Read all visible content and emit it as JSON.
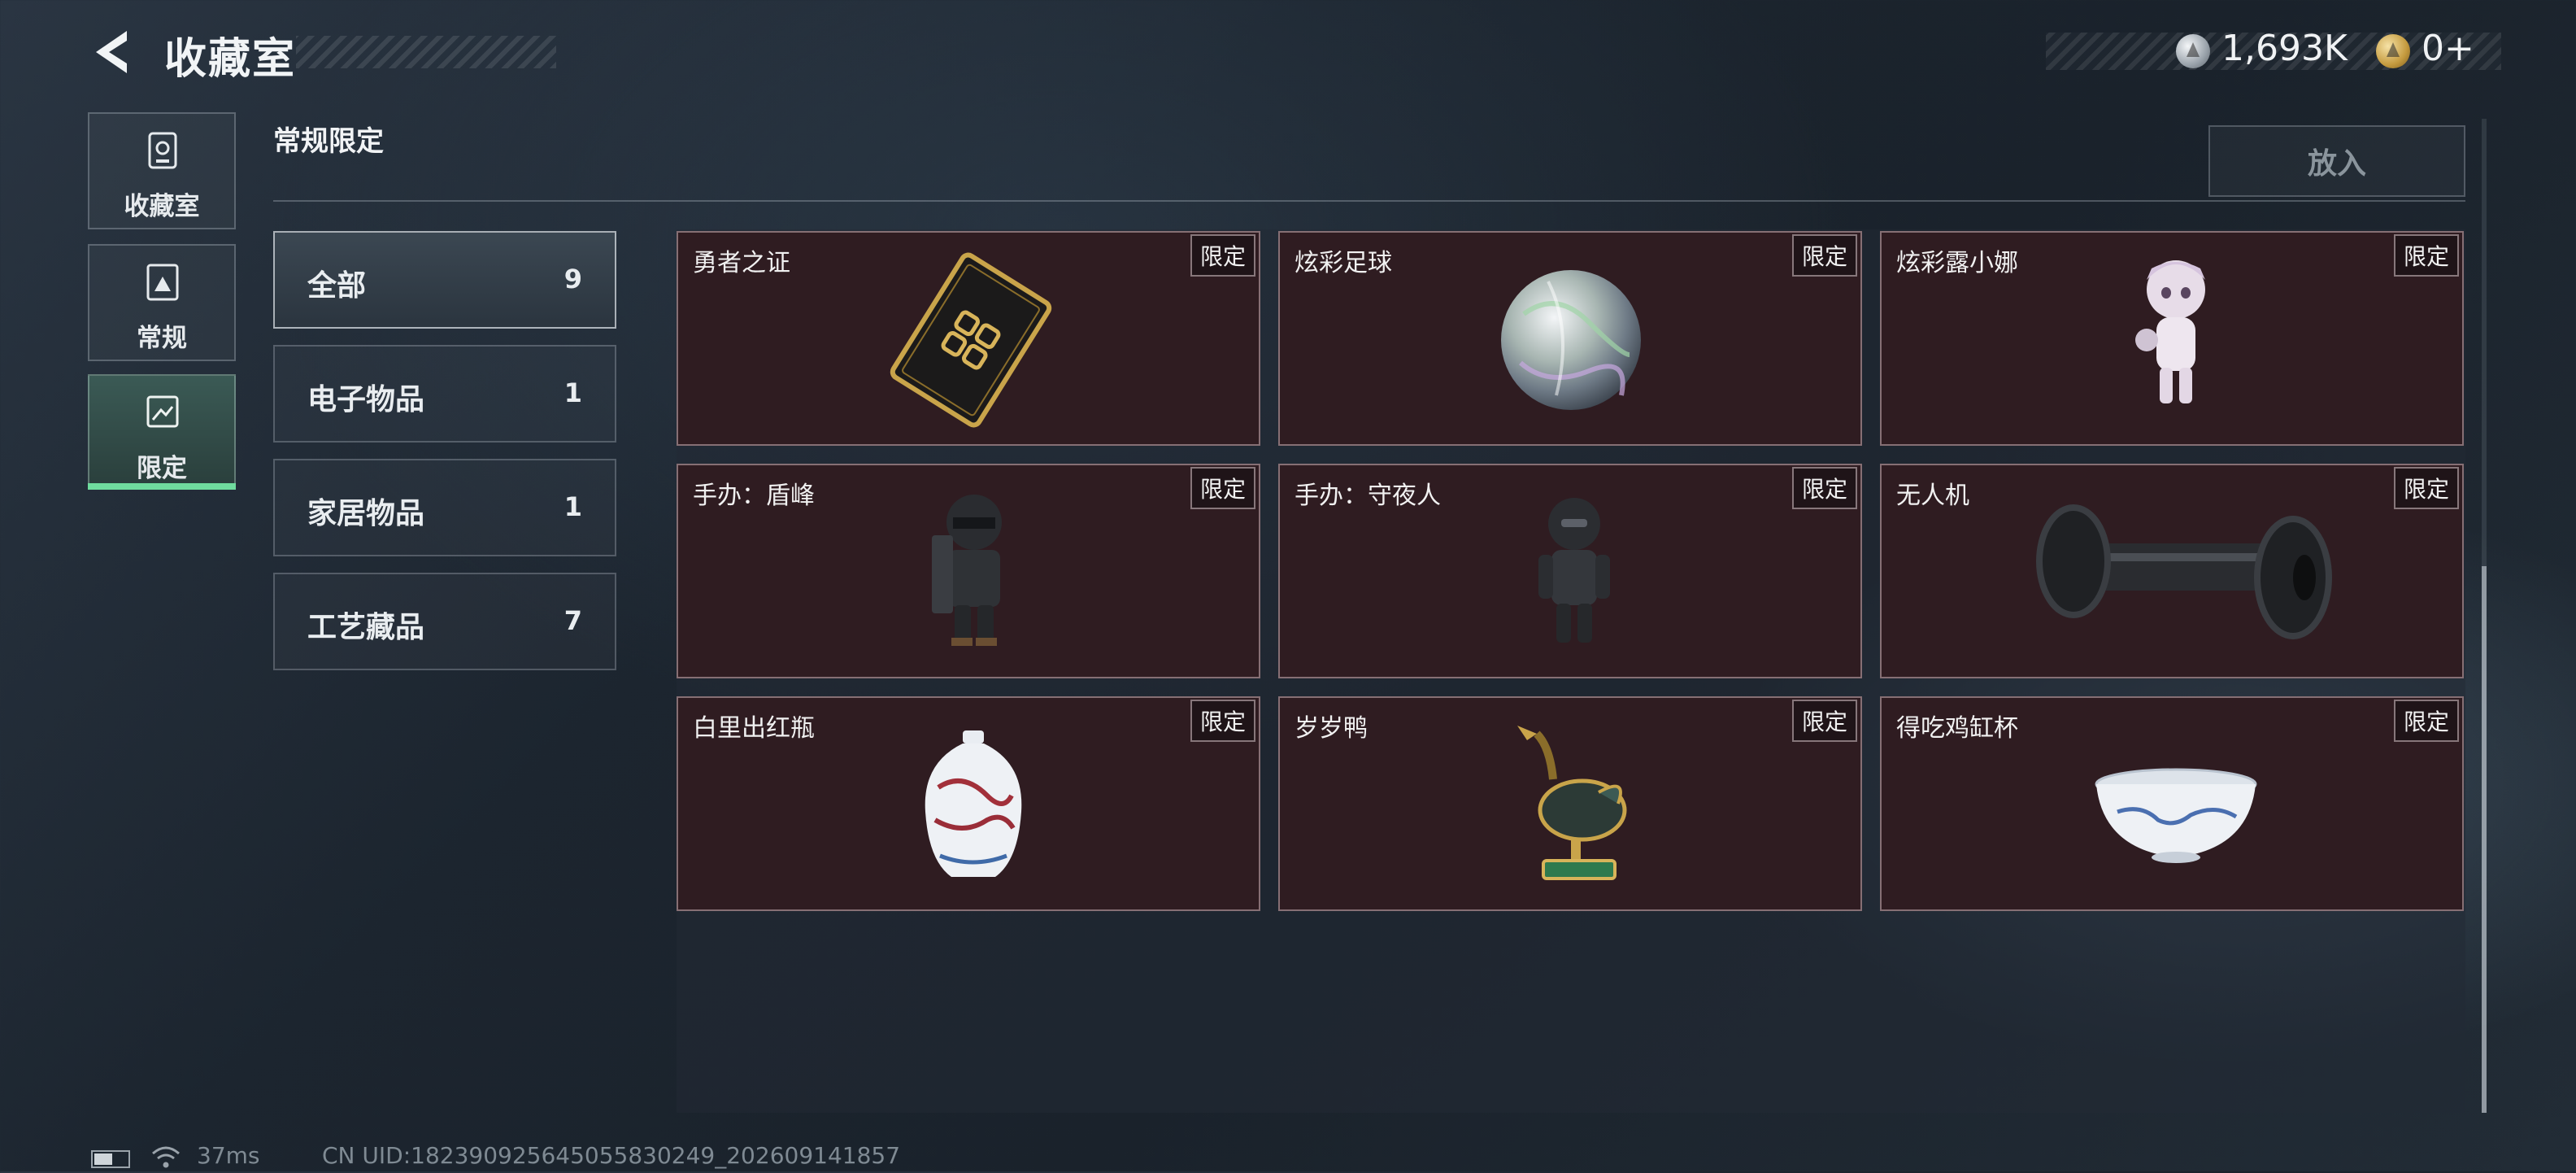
{
  "header": {
    "title": "收藏室",
    "currencies": [
      {
        "icon": "silver-coin-icon",
        "value": "1,693K"
      },
      {
        "icon": "gold-coin-icon",
        "value": "0+"
      }
    ]
  },
  "rail": [
    {
      "label": "收藏室",
      "icon": "collection-room-icon",
      "active": false
    },
    {
      "label": "常规",
      "icon": "regular-icon",
      "active": false
    },
    {
      "label": "限定",
      "icon": "limited-icon",
      "active": true
    }
  ],
  "section": {
    "title": "常规限定",
    "put_button": "放入"
  },
  "categories": [
    {
      "label": "全部",
      "count": "9",
      "active": true
    },
    {
      "label": "电子物品",
      "count": "1",
      "active": false
    },
    {
      "label": "家居物品",
      "count": "1",
      "active": false
    },
    {
      "label": "工艺藏品",
      "count": "7",
      "active": false
    }
  ],
  "items": [
    {
      "name": "勇者之证",
      "badge": "限定",
      "icon": "card-icon"
    },
    {
      "name": "炫彩足球",
      "badge": "限定",
      "icon": "ball-icon"
    },
    {
      "name": "炫彩露小娜",
      "badge": "限定",
      "icon": "doll-icon"
    },
    {
      "name": "手办：盾峰",
      "badge": "限定",
      "icon": "soldier-figure-icon"
    },
    {
      "name": "手办：守夜人",
      "badge": "限定",
      "icon": "masked-figure-icon"
    },
    {
      "name": "无人机",
      "badge": "限定",
      "icon": "drone-icon"
    },
    {
      "name": "白里出红瓶",
      "badge": "限定",
      "icon": "vase-icon"
    },
    {
      "name": "岁岁鸭",
      "badge": "限定",
      "icon": "duck-icon"
    },
    {
      "name": "得吃鸡缸杯",
      "badge": "限定",
      "icon": "bowl-icon"
    }
  ],
  "status": {
    "ping": "37ms",
    "uid": "CN UID:1823909256450558302​49_202609141857"
  },
  "colors": {
    "accent": "#6fdc9e",
    "card_bg": "#2f1c21"
  }
}
